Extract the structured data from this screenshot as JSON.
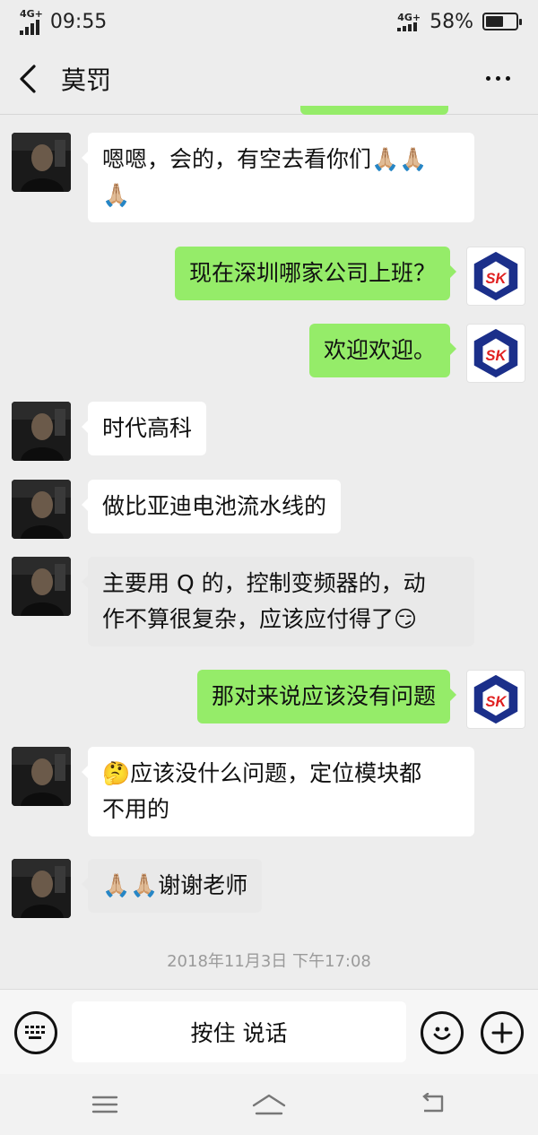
{
  "status_bar": {
    "network_left": "4G+",
    "time": "09:55",
    "network_right": "4G+",
    "battery_percent": "58%",
    "battery_level": 0.58
  },
  "header": {
    "back_icon": "chevron-left-icon",
    "title": "莫罚",
    "more_icon": "more-dots-icon"
  },
  "messages": [
    {
      "sender": "contact",
      "text": "嗯嗯，会的，有空去看你们🙏🏼🙏🏼\n🙏🏼"
    },
    {
      "sender": "me",
      "text": "现在深圳哪家公司上班？"
    },
    {
      "sender": "me",
      "text": "欢迎欢迎。"
    },
    {
      "sender": "contact",
      "text": "时代高科"
    },
    {
      "sender": "contact",
      "text": "做比亚迪电池流水线的"
    },
    {
      "sender": "contact",
      "text": "主要用 Q 的，控制变频器的，动\n作不算很复杂，应该应付得了😏"
    },
    {
      "sender": "me",
      "text": "那对来说应该没有问题"
    },
    {
      "sender": "contact",
      "text": "🤔应该没什么问题，定位模块都\n不用的"
    },
    {
      "sender": "contact",
      "text": "🙏🏼🙏🏼谢谢老师"
    }
  ],
  "sk_logo_text": "SK",
  "timestamp": "2018年11月3日 下午17:08",
  "input_bar": {
    "keyboard_icon": "keyboard-icon",
    "hold_to_talk_label": "按住 说话",
    "emoji_icon": "smiley-icon",
    "add_icon": "plus-icon"
  },
  "nav_bar": {
    "menu_icon": "menu-lines-icon",
    "home_icon": "home-icon",
    "back_icon": "return-icon"
  },
  "colors": {
    "background": "#ededed",
    "bubble_out": "#95ec69",
    "bubble_in": "#ffffff",
    "sk_logo_blue": "#1b2f8a",
    "sk_logo_red": "#e02020"
  }
}
